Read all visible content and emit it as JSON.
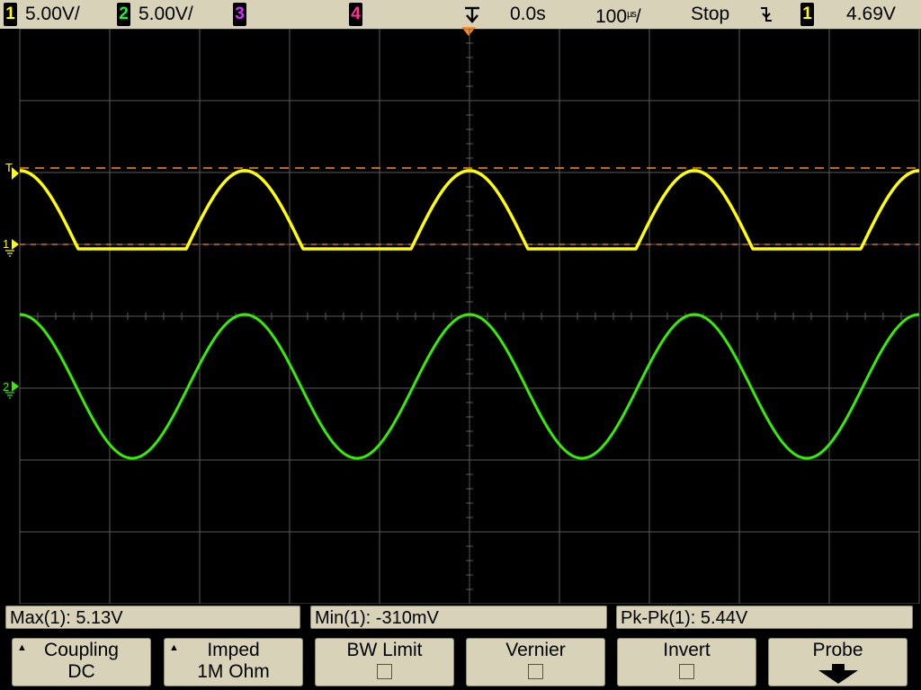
{
  "topbar": {
    "ch1": {
      "num": "1",
      "scale": "5.00V/"
    },
    "ch2": {
      "num": "2",
      "scale": "5.00V/"
    },
    "ch3": {
      "num": "3"
    },
    "ch4": {
      "num": "4"
    },
    "time_offset": "0.0s",
    "time_scale_num": "100",
    "time_scale_unit": "µs",
    "time_scale_suffix": "/",
    "run_state": "Stop",
    "trigger_edge_icon": "falling-edge-icon",
    "trigger_source": "1",
    "trigger_level": "4.69V"
  },
  "markers": {
    "trigger_level_label": "T",
    "ch1_ground_label": "1",
    "ch2_ground_label": "2"
  },
  "measurements": [
    {
      "label": "Max(1): 5.13V"
    },
    {
      "label": "Min(1): -310mV"
    },
    {
      "label": "Pk-Pk(1): 5.44V"
    }
  ],
  "softkeys": [
    {
      "label": "Coupling",
      "value": "DC",
      "kind": "select"
    },
    {
      "label": "Imped",
      "value": "1M Ohm",
      "kind": "select"
    },
    {
      "label": "BW Limit",
      "kind": "checkbox",
      "checked": false
    },
    {
      "label": "Vernier",
      "kind": "checkbox",
      "checked": false
    },
    {
      "label": "Invert",
      "kind": "checkbox",
      "checked": false
    },
    {
      "label": "Probe",
      "kind": "submenu"
    }
  ],
  "colors": {
    "topbar_bg": "#d8d3b8",
    "ch1": "#ffff00",
    "ch2": "#33ee00",
    "ch3": "#cc33ff",
    "ch4": "#ff3399",
    "marker": "#ff8c1a",
    "grid": "#5a5a5a"
  },
  "chart_data": {
    "type": "line",
    "xlabel": "",
    "ylabel": "",
    "divisions_x": 10,
    "divisions_y": 8,
    "time_per_div_us": 100,
    "volts_per_div": 5,
    "series": [
      {
        "name": "1",
        "color": "#ffff00",
        "kind": "half-wave rectified sine",
        "period_us": 250,
        "peak_V": 5.13,
        "floor_V": -0.31,
        "peak_time_us": 0,
        "visible_peaks_us": [
          -270,
          -20,
          230,
          480
        ]
      },
      {
        "name": "2",
        "color": "#33ee00",
        "kind": "sine",
        "period_us": 250,
        "amplitude_V": 5,
        "offset_V": 0,
        "peak_time_us": 0,
        "visible_peaks_us": [
          -270,
          -20,
          230,
          480
        ]
      }
    ]
  }
}
